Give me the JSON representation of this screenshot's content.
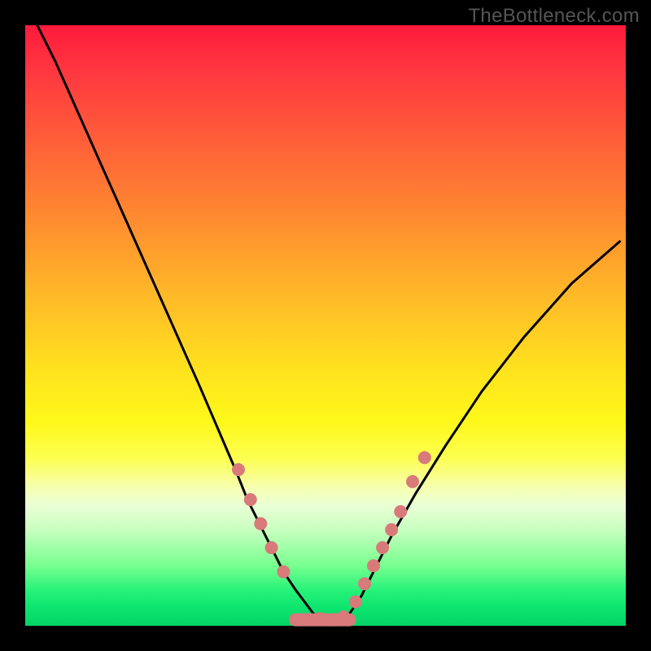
{
  "watermark": "TheBottleneck.com",
  "chart_data": {
    "type": "line",
    "title": "",
    "xlabel": "",
    "ylabel": "",
    "xlim": [
      0,
      100
    ],
    "ylim": [
      0,
      100
    ],
    "series": [
      {
        "name": "bottleneck-curve",
        "x": [
          2,
          5,
          9,
          13,
          17,
          21,
          25,
          29,
          32,
          35,
          37,
          39,
          41,
          43,
          45,
          46.5,
          48,
          50,
          52,
          54,
          56,
          58,
          61,
          65,
          70,
          76,
          83,
          91,
          99
        ],
        "y": [
          100,
          94,
          85,
          76,
          67,
          58,
          49,
          40,
          33,
          26,
          21,
          17,
          13,
          9,
          6,
          4,
          2,
          1,
          1,
          2,
          5,
          9,
          15,
          22,
          30,
          39,
          48,
          57,
          64
        ]
      }
    ],
    "markers": [
      {
        "name": "curve-dots",
        "color": "#d87a7a",
        "points": [
          {
            "x": 35.5,
            "y": 26
          },
          {
            "x": 37.5,
            "y": 21
          },
          {
            "x": 39.2,
            "y": 17
          },
          {
            "x": 41.0,
            "y": 13
          },
          {
            "x": 43.0,
            "y": 9
          },
          {
            "x": 49.0,
            "y": 1.2
          },
          {
            "x": 51.0,
            "y": 1.0
          },
          {
            "x": 53.0,
            "y": 1.5
          },
          {
            "x": 55.0,
            "y": 4
          },
          {
            "x": 56.5,
            "y": 7
          },
          {
            "x": 58.0,
            "y": 10
          },
          {
            "x": 59.5,
            "y": 13
          },
          {
            "x": 61.0,
            "y": 16
          },
          {
            "x": 62.5,
            "y": 19
          },
          {
            "x": 64.5,
            "y": 24
          },
          {
            "x": 66.5,
            "y": 28
          }
        ]
      }
    ],
    "flat_segment": {
      "name": "valley-flat",
      "color": "#d87a7a",
      "x_start": 45,
      "x_end": 54,
      "y": 1
    },
    "colors": {
      "curve": "#000000",
      "marker": "#d87a7a",
      "frame": "#000000"
    }
  }
}
